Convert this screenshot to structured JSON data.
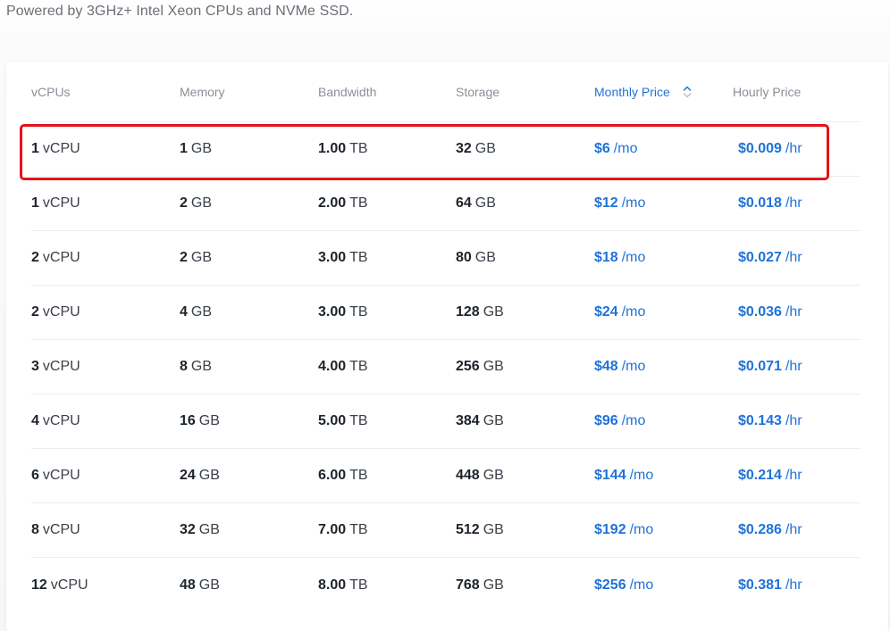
{
  "subtitle": "Powered by 3GHz+ Intel Xeon CPUs and NVMe SSD.",
  "colors": {
    "accent": "#1f72d8",
    "highlight_border": "#e3121a",
    "header_text": "#8a8f98"
  },
  "table": {
    "headers": {
      "vcpus": "vCPUs",
      "memory": "Memory",
      "bandwidth": "Bandwidth",
      "storage": "Storage",
      "monthly": "Monthly Price",
      "hourly": "Hourly Price"
    },
    "sort_icon": "sort-up-down-icon",
    "rows": [
      {
        "vcpu_num": "1",
        "vcpu_unit": "vCPU",
        "mem_num": "1",
        "mem_unit": "GB",
        "bw_num": "1.00",
        "bw_unit": "TB",
        "st_num": "32",
        "st_unit": "GB",
        "mo_num": "$6",
        "mo_unit": "/mo",
        "hr_num": "$0.009",
        "hr_unit": "/hr"
      },
      {
        "vcpu_num": "1",
        "vcpu_unit": "vCPU",
        "mem_num": "2",
        "mem_unit": "GB",
        "bw_num": "2.00",
        "bw_unit": "TB",
        "st_num": "64",
        "st_unit": "GB",
        "mo_num": "$12",
        "mo_unit": "/mo",
        "hr_num": "$0.018",
        "hr_unit": "/hr"
      },
      {
        "vcpu_num": "2",
        "vcpu_unit": "vCPU",
        "mem_num": "2",
        "mem_unit": "GB",
        "bw_num": "3.00",
        "bw_unit": "TB",
        "st_num": "80",
        "st_unit": "GB",
        "mo_num": "$18",
        "mo_unit": "/mo",
        "hr_num": "$0.027",
        "hr_unit": "/hr"
      },
      {
        "vcpu_num": "2",
        "vcpu_unit": "vCPU",
        "mem_num": "4",
        "mem_unit": "GB",
        "bw_num": "3.00",
        "bw_unit": "TB",
        "st_num": "128",
        "st_unit": "GB",
        "mo_num": "$24",
        "mo_unit": "/mo",
        "hr_num": "$0.036",
        "hr_unit": "/hr"
      },
      {
        "vcpu_num": "3",
        "vcpu_unit": "vCPU",
        "mem_num": "8",
        "mem_unit": "GB",
        "bw_num": "4.00",
        "bw_unit": "TB",
        "st_num": "256",
        "st_unit": "GB",
        "mo_num": "$48",
        "mo_unit": "/mo",
        "hr_num": "$0.071",
        "hr_unit": "/hr"
      },
      {
        "vcpu_num": "4",
        "vcpu_unit": "vCPU",
        "mem_num": "16",
        "mem_unit": "GB",
        "bw_num": "5.00",
        "bw_unit": "TB",
        "st_num": "384",
        "st_unit": "GB",
        "mo_num": "$96",
        "mo_unit": "/mo",
        "hr_num": "$0.143",
        "hr_unit": "/hr"
      },
      {
        "vcpu_num": "6",
        "vcpu_unit": "vCPU",
        "mem_num": "24",
        "mem_unit": "GB",
        "bw_num": "6.00",
        "bw_unit": "TB",
        "st_num": "448",
        "st_unit": "GB",
        "mo_num": "$144",
        "mo_unit": "/mo",
        "hr_num": "$0.214",
        "hr_unit": "/hr"
      },
      {
        "vcpu_num": "8",
        "vcpu_unit": "vCPU",
        "mem_num": "32",
        "mem_unit": "GB",
        "bw_num": "7.00",
        "bw_unit": "TB",
        "st_num": "512",
        "st_unit": "GB",
        "mo_num": "$192",
        "mo_unit": "/mo",
        "hr_num": "$0.286",
        "hr_unit": "/hr"
      },
      {
        "vcpu_num": "12",
        "vcpu_unit": "vCPU",
        "mem_num": "48",
        "mem_unit": "GB",
        "bw_num": "8.00",
        "bw_unit": "TB",
        "st_num": "768",
        "st_unit": "GB",
        "mo_num": "$256",
        "mo_unit": "/mo",
        "hr_num": "$0.381",
        "hr_unit": "/hr"
      }
    ]
  }
}
